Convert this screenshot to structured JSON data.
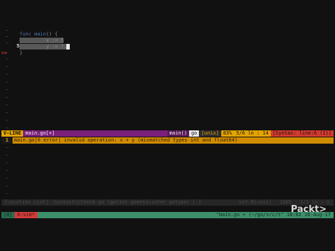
{
  "editor": {
    "lines": [
      {
        "number": "",
        "content": "func main() {"
      },
      {
        "number": "",
        "content": "x := 5"
      },
      {
        "number": "5",
        "content": "y := 7.5"
      },
      {
        "number": "",
        "content": "}"
      }
    ],
    "code": {
      "kw_func": "func",
      "fn_main": "main",
      "open": "() {",
      "l2_sel": "x := 5",
      "l3_sel": "y := 7.",
      "close": "}"
    },
    "sign": ">>",
    "tilde": "~"
  },
  "statusline": {
    "mode": "V-LINE",
    "file": "main.go[+]",
    "func": "main()",
    "filetype": "go",
    "format": "[unix]",
    "percent": "83%",
    "position": "5/6 ln : 14",
    "syntastic": "[Syntax: line:6 (1)]"
  },
  "quickfix": {
    "number": "1",
    "text": "main.go|6 error| invalid operation: x + y (mismatched types int and float64)"
  },
  "quickfix_statusline": {
    "left": "[Location List] :SyntasticCheck go (golint gometalinter gotype) [-]",
    "filetype": "utf-8[unix]",
    "percent": "100%",
    "position": "1/1 ln : 1"
  },
  "tmux": {
    "session": "[0]",
    "window": "0:vim*",
    "right": "\"main.go + (~/go/src/t\" 18:02 16-Aug-17"
  },
  "watermark": "Packt>"
}
